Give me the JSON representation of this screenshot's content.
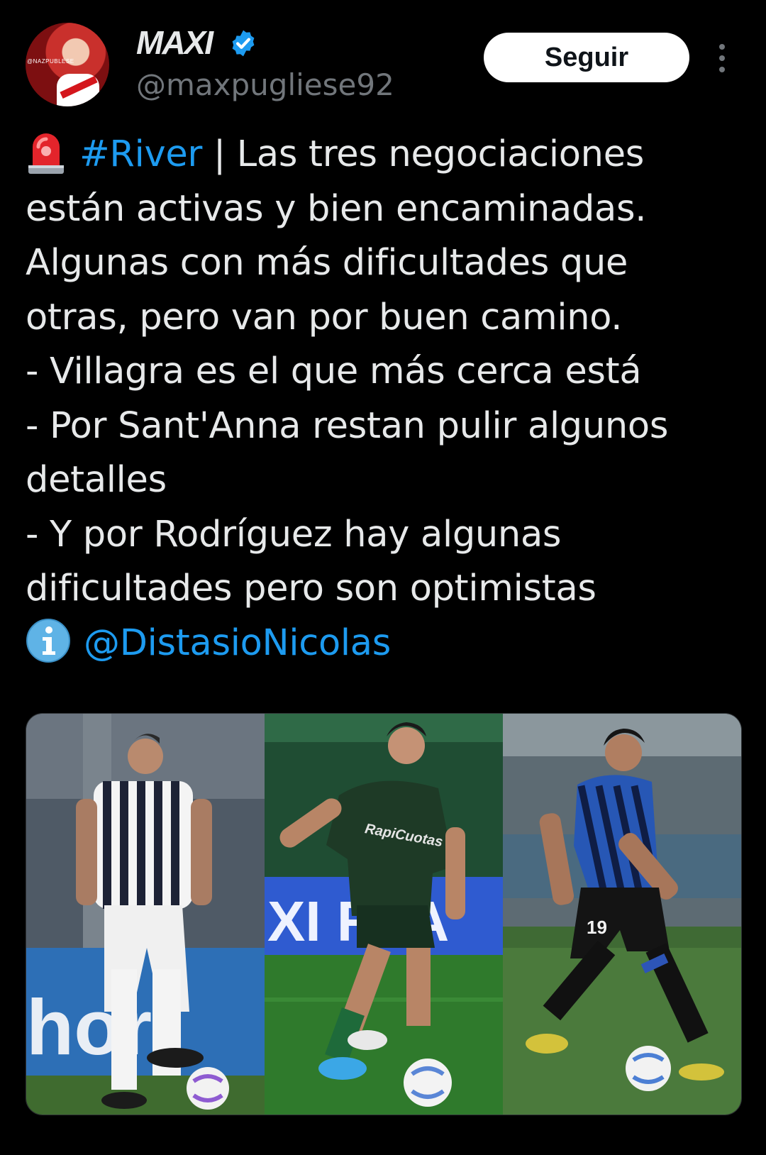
{
  "author": {
    "name": "MAXI",
    "handle": "@maxpugliese92",
    "verified": true,
    "avatar_tag": "@NAZPUBLESE"
  },
  "header": {
    "follow_label": "Seguir",
    "more_icon": "more-vertical-icon"
  },
  "tweet": {
    "siren_icon": "police-light-emoji",
    "hashtag": "#River",
    "line1_rest": " | Las tres negociaciones",
    "line2": "están activas y bien encaminadas.",
    "line3": "Algunas con más dificultades que",
    "line4": "otras, pero van por buen camino.",
    "line5": "- Villagra es el que más cerca está",
    "line6": "- Por Sant'Anna restan pulir algunos",
    "line7": "detalles",
    "line8": "- Y por Rodríguez hay algunas",
    "line9": "dificultades pero son optimistas",
    "info_icon": "information-emoji",
    "mention": "@DistasioNicolas"
  },
  "media": {
    "photos": [
      {
        "jersey_number": "",
        "ad_text": "hor"
      },
      {
        "jersey_number": "",
        "ad_text": "XI RTA",
        "sponsor": "RapiCuotas"
      },
      {
        "jersey_number": "19",
        "ad_text": ""
      }
    ]
  },
  "colors": {
    "background": "#000000",
    "text": "#e7e9ea",
    "secondary": "#71767b",
    "link": "#1d9bf0",
    "verified": "#1d9bf0"
  }
}
